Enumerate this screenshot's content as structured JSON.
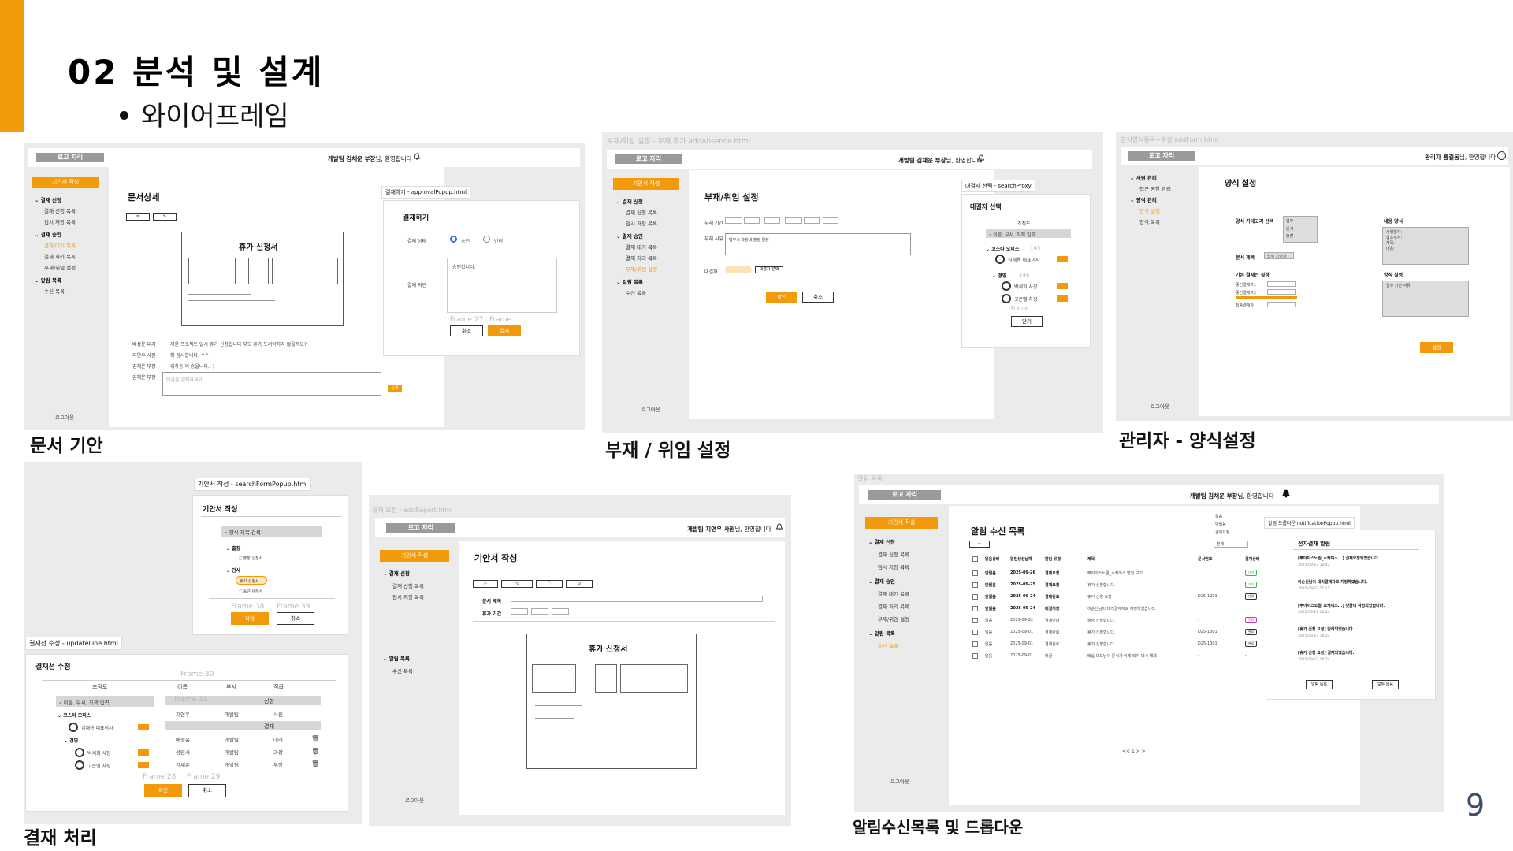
{
  "slide": {
    "title": "02 분석 및 설계",
    "subtitle": "와이어프레임",
    "page_number": "9"
  },
  "colors": {
    "accent": "#f39a0a",
    "panel_bg": "#ebebeb",
    "page_number": "#3e4e6a"
  },
  "captions": {
    "doc": "문서 기안",
    "absence": "부재 / 위임 설정",
    "admin": "관리자 - 양식설정",
    "approval": "결재 처리",
    "notify": "알림수신목록 및 드롭다운"
  },
  "common": {
    "logo": "로고 자리",
    "logout": "로그아웃",
    "draft_button": "기안서 작성",
    "approval_group": "결재 신청",
    "approval_request_list": "결재 신청 목록",
    "temp_saved_list": "임시 저장 목록",
    "approval_approve_group": "결재 승인",
    "pending_list": "결재 대기 목록",
    "processed_list": "결재 처리 목록",
    "absence_setting": "부재/위임 설정",
    "notify_group": "알림 목록",
    "received_list": "수신 목록",
    "user_welcome_name": "개발팀 김채운 부장",
    "user_welcome_suffix": "님, 환영합니다",
    "user2_welcome_name": "개발팀 지연우 사원",
    "admin_welcome_name": "관리자 홍길동",
    "confirm": "확인",
    "cancel": "취소",
    "close": "닫기",
    "vacation_form_title": "휴가 신청서"
  },
  "doc_panel": {
    "title": "문서상세",
    "popup_tag": "결재하기 - approvalPopup.html",
    "popup_title": "결재하기",
    "status_label": "결재 상태",
    "radio_approve": "승인",
    "radio_reject": "반려",
    "opinion_label": "결재 의견",
    "opinion_value": "승인합니다.",
    "btn_approve": "결재",
    "ghost1": "Frame 27",
    "ghost2": "Frame",
    "history": [
      {
        "label": "배성윤 대리",
        "text": "저한 프로젝트 일시 휴가 신청합니다 부모 휴가 드려야하지 않을까요?"
      },
      {
        "label": "지연우 사원",
        "text": "확 감사합니다. ^^"
      },
      {
        "label": "김채운 부장",
        "text": "위하동 이 승을니다.. )"
      },
      {
        "label": "김채운 부장",
        "text": ""
      }
    ],
    "comment_placeholder": "댓글을 입력하세요.",
    "comment_btn": "등록"
  },
  "absence_panel": {
    "url": "부재/위임 설정 - 부재 추가 addAbsence.html",
    "title": "부재/위임 설정",
    "period_label": "부재 기간",
    "reason_label": "부재 사유",
    "reason_value": "업무시 과장내 출장 일정",
    "proxy_label": "대결자",
    "proxy_btn": "대결자 선택",
    "popup_tag": "대결자 선택 - searchProxy",
    "popup_title": "대결자 선택",
    "org_label": "조직도",
    "search_placeholder": "이름, 부서, 직책 입력",
    "company": "코스타 오피스",
    "ceo": "심재용 대표이사",
    "dept": "경영",
    "person1": "박세희 사장",
    "person2": "고은별 차장",
    "ghost1": "145",
    "ghost2": "146",
    "ghost3": "Frame"
  },
  "admin_panel": {
    "url": "양식양식등록+수정 addForm.html",
    "menu_user": "사원 관리",
    "menu_access": "접근 권한 관리",
    "menu_form": "양식 관리",
    "menu_form_setting": "양식 설정",
    "menu_form_list": "양식 목록",
    "title": "양식 설정",
    "category_label": "양식 카테고리 선택",
    "category_value": "업무",
    "category_options": [
      "인사",
      "출장"
    ],
    "content_label": "내용 양식",
    "content_lines": [
      "시행일자:",
      "협조부서:",
      "제목:",
      "내용:"
    ],
    "doc_title_label": "문서 제목",
    "doc_title_value": "업무 기안서",
    "line_label": "기본 결재선 설정",
    "mid1": "중간결재자1",
    "mid2": "중간결재자2",
    "final": "최종결재자",
    "desc_label": "양식 설명",
    "desc_value": "업무 기안 서류",
    "btn_save": "설정"
  },
  "approval_panel": {
    "popup_tag1": "기안서 작성 - searchFormPopup.html",
    "popup1_title": "기안서 작성",
    "form_search": "양식 제목 검색",
    "tree_trip": "출장",
    "tree_trip_item": "출장 신청서",
    "tree_hr": "인사",
    "tree_hr_item1": "휴가 신청서",
    "tree_hr_item2": "품근 세부서",
    "btn_write": "작성",
    "ghost1": "Frame 38",
    "ghost2": "Frame 39",
    "popup_tag2": "결재선 수정 - updateLine.html",
    "popup2_title": "결재선 수정",
    "org_label": "조직도",
    "col_name": "이름",
    "col_dept": "부서",
    "col_rank": "직급",
    "apply_label": "신청",
    "result_label": "결재",
    "ghost3": "Frame 30",
    "ghost4": "Frame 31",
    "ghost5": "Frame 28",
    "ghost6": "Frame 29",
    "applicant": {
      "name": "지연우",
      "dept": "개발팀",
      "rank": "사원"
    },
    "approvers": [
      {
        "name": "배성윤",
        "dept": "개발팀",
        "rank": "대리"
      },
      {
        "name": "성민서",
        "dept": "개발팀",
        "rank": "과장"
      },
      {
        "name": "김채운",
        "dept": "개발팀",
        "rank": "부장"
      }
    ]
  },
  "report_panel": {
    "url": "결재 요청 - addReport.html",
    "title": "기안서 작성",
    "doc_title_label": "문서 제목",
    "period_label": "휴가 기간"
  },
  "notify_panel": {
    "url": "알림 목록",
    "title": "알림 수신 목록",
    "filter_all": "전체",
    "filter_options": [
      "읽음",
      "안읽음",
      "결재요청"
    ],
    "popup_tag": "알림 드롭다운 notificationPopup.html",
    "popup_title": "전자결재 알림",
    "headers": [
      "읽음상태",
      "알림생성날짜",
      "알림 유형",
      "제목",
      "문서번호",
      "결재상태"
    ],
    "rows": [
      [
        "안읽음",
        "2025-09-26",
        "결재요청",
        "뿌아이스노릴_쇼케이스 방인 보고",
        "",
        "대기"
      ],
      [
        "안읽음",
        "2025-09-25",
        "결재요청",
        "휴가 신청합니다.",
        "",
        "대기"
      ],
      [
        "안읽음",
        "2025-09-24",
        "결재완료",
        "휴가 신청 요청",
        "D25-1201",
        "완료"
      ],
      [
        "안읽음",
        "2025-09-24",
        "대결지정",
        "이순신님이 대리결재자로 지정하였습니다.",
        "-",
        "-"
      ],
      [
        "읽음",
        "2025-09-22",
        "결재반려",
        "출장 신청합니다.",
        "-",
        "반려"
      ],
      [
        "읽음",
        "2025-09-01",
        "결재완료",
        "휴가 신청합니다.",
        "D25-1301",
        "완료"
      ],
      [
        "읽음",
        "2025-09-01",
        "결재완료",
        "휴가 신청합니다.",
        "D25-1301",
        "완료"
      ],
      [
        "읽음",
        "2025-09-01",
        "댓글",
        "배솜 대표님이 문서가 이제 되어 다시 해제",
        "-",
        "-"
      ]
    ],
    "pager": "<< 1 > >",
    "popup_items": [
      {
        "title": "[뿌아이스노릴_쇼케이스...] 결재요청되었습니다.",
        "time": "2025-09-27 10:42"
      },
      {
        "title": "이순신님이 대리결재자로 지정하였습니다.",
        "time": "2025-09-27 11:15"
      },
      {
        "title": "[뿌아이스노릴_쇼케이스...] 댓글이 작성되었습니다.",
        "time": "2025-09-27 14:24"
      },
      {
        "title": "[휴가 신청 요청] 반려되었습니다.",
        "time": "2025-09-27 14:24"
      },
      {
        "title": "[휴가 신청 요청] 결재되었습니다.",
        "time": "2025-09-27 14:24"
      }
    ],
    "btn_list": "알림 목록",
    "btn_read_all": "모두 읽음"
  }
}
